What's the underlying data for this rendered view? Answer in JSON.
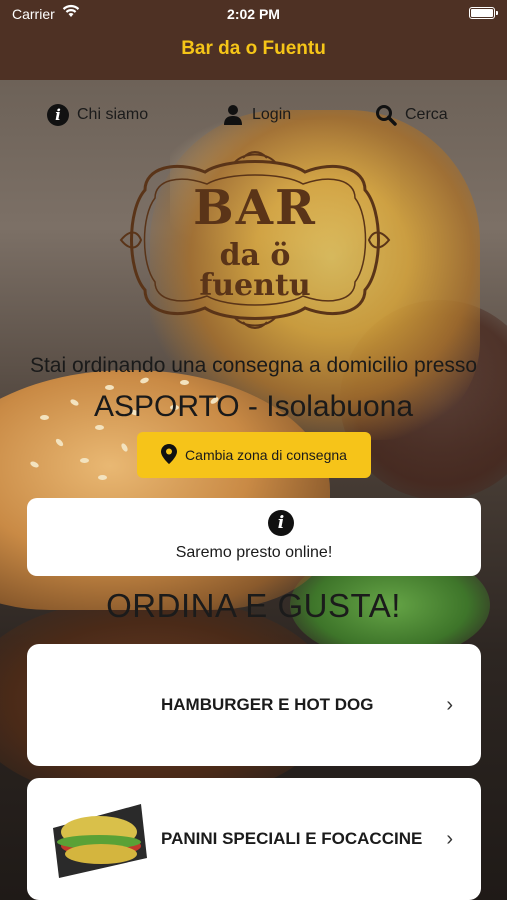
{
  "status_bar": {
    "carrier": "Carrier",
    "time": "2:02 PM"
  },
  "nav": {
    "title": "Bar da o Fuentu"
  },
  "links": [
    {
      "label": "Chi siamo",
      "icon": "info-icon"
    },
    {
      "label": "Login",
      "icon": "user-icon"
    },
    {
      "label": "Cerca",
      "icon": "search-icon"
    }
  ],
  "logo": {
    "line1": "BAR",
    "line2": "da ö",
    "line3": "fuentu"
  },
  "delivery": {
    "text": "Stai ordinando una consegna a domicilio presso",
    "zone": "ASPORTO - Isolabuona",
    "button_label": "Cambia zona di consegna"
  },
  "notice": {
    "message": "Saremo presto online!"
  },
  "headline": "ORDINA E GUSTA!",
  "categories": [
    {
      "label": "HAMBURGER E HOT DOG"
    },
    {
      "label": "PANINI SPECIALI E FOCACCINE"
    }
  ],
  "colors": {
    "nav_bg": "#4e3124",
    "nav_title": "#f5c518",
    "accent": "#f6c419",
    "logo_brown": "#5a3418"
  }
}
